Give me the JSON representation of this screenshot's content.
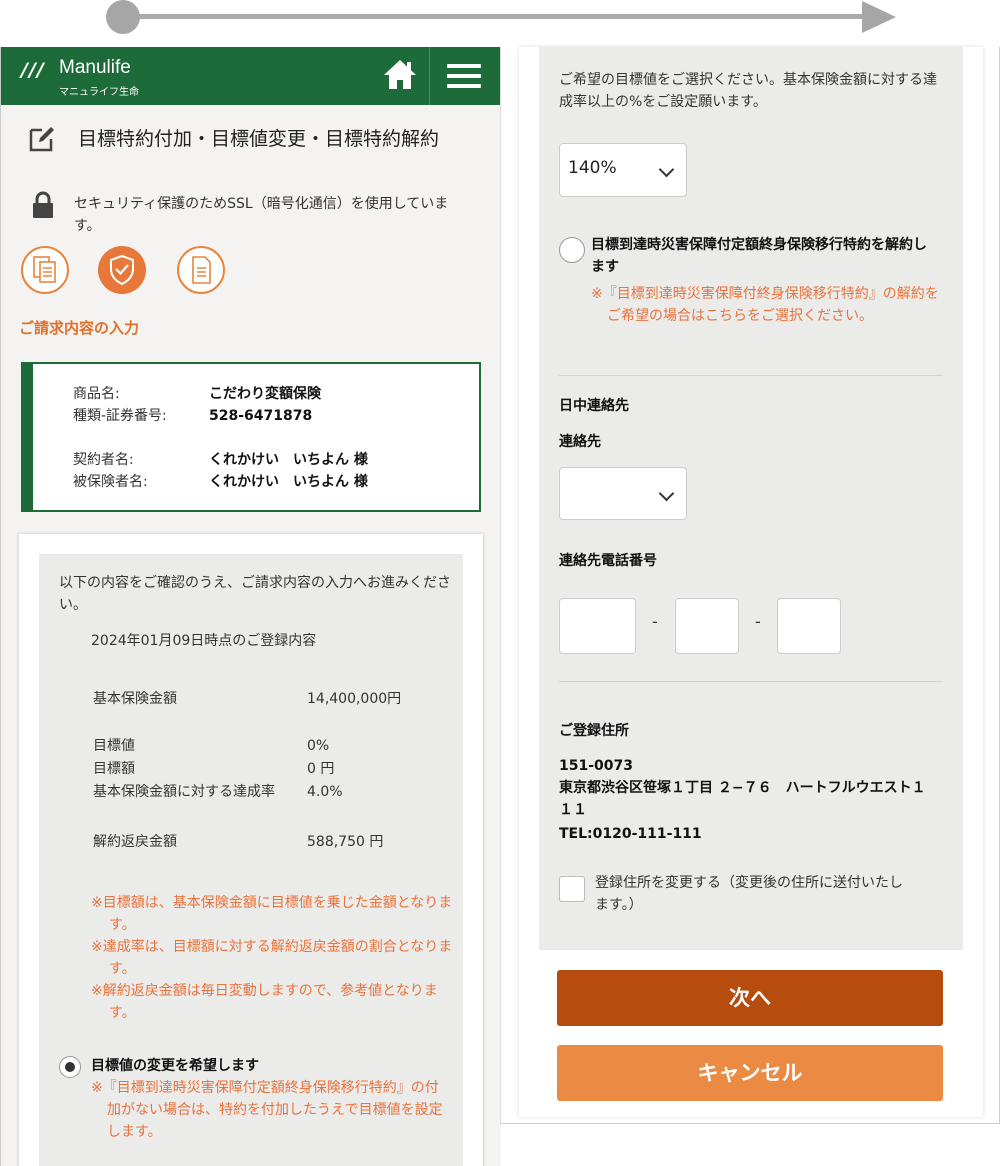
{
  "header": {
    "logo_mark": "///",
    "logo_name": "Manulife",
    "logo_sub": "マニュライフ生命"
  },
  "page": {
    "title": "目標特約付加・目標値変更・目標特約解約",
    "ssl_notice": "セキュリティ保護のためSSL（暗号化通信）を使用しています。",
    "step_label": "ご請求内容の入力"
  },
  "product": {
    "rows": [
      {
        "label": "商品名:",
        "value": "こだわり変額保険"
      },
      {
        "label": "種類-証券番号:",
        "value": "528-6471878"
      },
      {
        "label": "契約者名:",
        "value": "くれかけい　いちよん 様"
      },
      {
        "label": "被保険者名:",
        "value": "くれかけい　いちよん 様"
      }
    ]
  },
  "confirm": {
    "intro": "以下の内容をご確認のうえ、ご請求内容の入力へお進みください。",
    "date_line": "2024年01月09日時点のご登録内容",
    "items": [
      {
        "label": "基本保険金額",
        "value": "14,400,000円"
      },
      {
        "label": "目標値",
        "value": "0%"
      },
      {
        "label": "目標額",
        "value": "0 円"
      },
      {
        "label": "基本保険金額に対する達成率",
        "value": "4.0%"
      },
      {
        "label": "解約返戻金額",
        "value": "588,750 円"
      }
    ],
    "notes": [
      "※目標額は、基本保険金額に目標値を乗じた金額となります。",
      "※達成率は、目標額に対する解約返戻金額の割合となります。",
      "※解約返戻金額は毎日変動しますので、参考値となります。"
    ],
    "option_change": {
      "label": "目標値の変更を希望します",
      "note": "※『目標到達時災害保障付定額終身保険移行特約』の付加がない場合は、特約を付加したうえで目標値を設定します。"
    }
  },
  "right": {
    "target_instruction": "ご希望の目標値をご選択ください。基本保険金額に対する達成率以上の%をご設定願います。",
    "target_select_value": "140%",
    "option_cancel": {
      "label": "目標到達時災害保障付定額終身保険移行特約を解約します",
      "note": "※『目標到達時災害保障付終身保険移行特約』の解約をご希望の場合はこちらをご選択ください。"
    },
    "daytime_contact_heading": "日中連絡先",
    "contact_label": "連絡先",
    "contact_select_value": "",
    "phone_label": "連絡先電話番号",
    "phone_separator": "-",
    "address_heading": "ご登録住所",
    "postal_code": "151-0073",
    "address": "東京都渋谷区笹塚１丁目 ２−７６　ハートフルウエスト１１１",
    "tel": "TEL:0120-111-111",
    "change_address_label": "登録住所を変更する（変更後の住所に送付いたします。）",
    "next_button": "次へ",
    "cancel_button": "キャンセル"
  },
  "colors": {
    "brand_green": "#1e6b3a",
    "accent_orange": "#e8773a",
    "next_button": "#b64d0e",
    "cancel_button": "#eb8a43",
    "note_text": "#e8733c"
  },
  "icons": [
    "home-icon",
    "menu-icon",
    "edit-icon",
    "lock-icon",
    "documents-icon",
    "shield-check-icon",
    "document-icon",
    "chevron-down-icon"
  ]
}
